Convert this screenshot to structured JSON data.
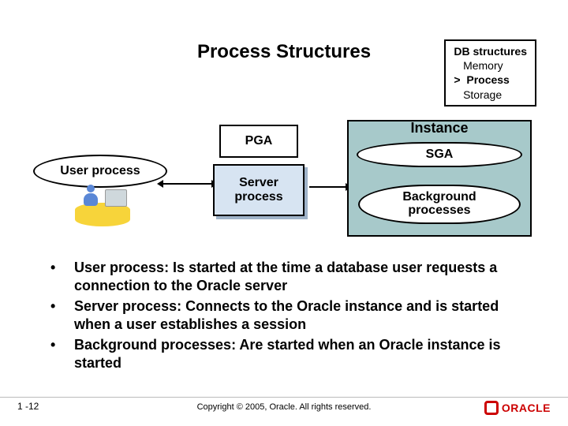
{
  "title": "Process Structures",
  "nav": {
    "item0": "DB structures",
    "item1": "   Memory",
    "item2": ">  Process",
    "item3": "   Storage"
  },
  "diagram": {
    "user_process": "User process",
    "pga": "PGA",
    "server_process": "Server\nprocess",
    "instance": "Instance",
    "sga": "SGA",
    "background_processes": "Background\nprocesses"
  },
  "bullets": [
    "User process: Is started at the time a database user requests a connection to the Oracle server",
    "Server process: Connects to the Oracle instance and is started when a user establishes a session",
    "Background processes: Are started when an Oracle instance is started"
  ],
  "footer": {
    "page": "1 -12",
    "copyright": "Copyright © 2005, Oracle.  All rights reserved.",
    "logo": "ORACLE"
  }
}
